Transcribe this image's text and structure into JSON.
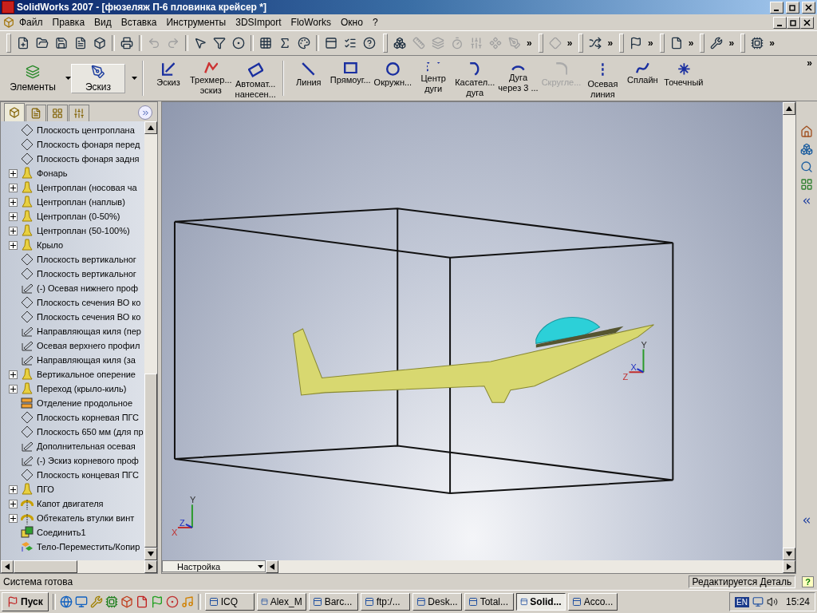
{
  "window": {
    "title": "SolidWorks 2007 - [фюзеляж П-6 пловинка крейсер *]"
  },
  "menu": [
    "Файл",
    "Правка",
    "Вид",
    "Вставка",
    "Инструменты",
    "3DSImport",
    "FloWorks",
    "Окно",
    "?"
  ],
  "standard_toolbar": [
    {
      "kind": "button",
      "disabled": false
    },
    {
      "kind": "button",
      "disabled": false
    },
    {
      "kind": "button",
      "disabled": false
    },
    {
      "kind": "button",
      "disabled": false
    },
    {
      "kind": "button",
      "disabled": false
    },
    {
      "kind": "separator"
    },
    {
      "kind": "button",
      "disabled": false
    },
    {
      "kind": "separator"
    },
    {
      "kind": "button",
      "disabled": true
    },
    {
      "kind": "button",
      "disabled": true
    },
    {
      "kind": "separator"
    },
    {
      "kind": "button",
      "disabled": false
    },
    {
      "kind": "button",
      "disabled": false
    },
    {
      "kind": "button",
      "disabled": false
    },
    {
      "kind": "separator"
    },
    {
      "kind": "button",
      "disabled": false
    },
    {
      "kind": "button",
      "disabled": false
    },
    {
      "kind": "button",
      "disabled": false
    },
    {
      "kind": "separator"
    },
    {
      "kind": "button",
      "disabled": false
    },
    {
      "kind": "button",
      "disabled": false
    },
    {
      "kind": "button",
      "disabled": false
    },
    {
      "kind": "grip"
    },
    {
      "kind": "button",
      "disabled": false
    },
    {
      "kind": "button",
      "disabled": true
    },
    {
      "kind": "button",
      "disabled": true
    },
    {
      "kind": "button",
      "disabled": true
    },
    {
      "kind": "button",
      "disabled": true
    },
    {
      "kind": "button",
      "disabled": true
    },
    {
      "kind": "button",
      "disabled": true
    },
    {
      "kind": "chevron",
      "label": "»"
    },
    {
      "kind": "grip"
    },
    {
      "kind": "button",
      "disabled": true
    },
    {
      "kind": "chevron",
      "label": "»"
    },
    {
      "kind": "grip"
    },
    {
      "kind": "button",
      "disabled": false
    },
    {
      "kind": "chevron",
      "label": "»"
    },
    {
      "kind": "grip"
    },
    {
      "kind": "button",
      "disabled": false
    },
    {
      "kind": "chevron",
      "label": "»"
    },
    {
      "kind": "grip"
    },
    {
      "kind": "button",
      "disabled": false
    },
    {
      "kind": "chevron",
      "label": "»"
    },
    {
      "kind": "grip"
    },
    {
      "kind": "button",
      "disabled": false
    },
    {
      "kind": "chevron",
      "label": "»"
    },
    {
      "kind": "grip"
    },
    {
      "kind": "button",
      "disabled": false
    },
    {
      "kind": "chevron",
      "label": "»"
    }
  ],
  "command_manager": [
    {
      "kind": "big",
      "label": "Элементы",
      "selected": false
    },
    {
      "kind": "big",
      "label": "Эскиз",
      "selected": true
    },
    {
      "kind": "separator"
    },
    {
      "kind": "tool",
      "label": "Эскиз",
      "disabled": false
    },
    {
      "kind": "tool",
      "label": "Трехмер...\nэскиз",
      "disabled": false
    },
    {
      "kind": "tool",
      "label": "Автомат...\nнанесен...",
      "disabled": false
    },
    {
      "kind": "separator"
    },
    {
      "kind": "tool",
      "label": "Линия",
      "disabled": false
    },
    {
      "kind": "tool",
      "label": "Прямоуг...",
      "disabled": false
    },
    {
      "kind": "tool",
      "label": "Окружн...",
      "disabled": false
    },
    {
      "kind": "tool",
      "label": "Центр\nдуги",
      "disabled": false
    },
    {
      "kind": "tool",
      "label": "Касател...\nдуга",
      "disabled": false
    },
    {
      "kind": "tool",
      "label": "Дуга\nчерез 3 ...",
      "disabled": false
    },
    {
      "kind": "tool",
      "label": "Скругле...",
      "disabled": true
    },
    {
      "kind": "tool",
      "label": "Осевая\nлиния",
      "disabled": false
    },
    {
      "kind": "tool",
      "label": "Сплайн",
      "disabled": false
    },
    {
      "kind": "tool",
      "label": "Точечный",
      "disabled": false
    }
  ],
  "command_manager_more": "»",
  "tree_tabs": [
    {
      "selected": true
    },
    {
      "selected": false
    },
    {
      "selected": false
    },
    {
      "selected": false
    }
  ],
  "tree": [
    {
      "kind": "plane",
      "label": "Плоскость центроплана",
      "expandable": false
    },
    {
      "kind": "plane",
      "label": "Плоскость фонаря перед",
      "expandable": false
    },
    {
      "kind": "plane",
      "label": "Плоскость фонаря задня",
      "expandable": false
    },
    {
      "kind": "loft",
      "label": "Фонарь",
      "expandable": true
    },
    {
      "kind": "loft",
      "label": "Центроплан (носовая ча",
      "expandable": true
    },
    {
      "kind": "loft",
      "label": "Центроплан (наплыв)",
      "expandable": true
    },
    {
      "kind": "loft",
      "label": "Центроплан (0-50%)",
      "expandable": true
    },
    {
      "kind": "loft",
      "label": "Центроплан (50-100%)",
      "expandable": true
    },
    {
      "kind": "loft",
      "label": "Крыло",
      "expandable": true
    },
    {
      "kind": "plane",
      "label": "Плоскость вертикальног",
      "expandable": false
    },
    {
      "kind": "plane",
      "label": "Плоскость вертикальног",
      "expandable": false
    },
    {
      "kind": "sketch",
      "label": "(-) Осевая нижнего проф",
      "expandable": false
    },
    {
      "kind": "plane",
      "label": "Плоскость сечения ВО ко",
      "expandable": false
    },
    {
      "kind": "plane",
      "label": "Плоскость сечения ВО ко",
      "expandable": false
    },
    {
      "kind": "sketch",
      "label": "Направляющая киля (пер",
      "expandable": false
    },
    {
      "kind": "sketch",
      "label": "Осевая верхнего профил",
      "expandable": false
    },
    {
      "kind": "sketch",
      "label": "Направляющая киля (за",
      "expandable": false
    },
    {
      "kind": "loft",
      "label": "Вертикальное оперение",
      "expandable": true
    },
    {
      "kind": "loft",
      "label": "Переход (крыло-киль)",
      "expandable": true
    },
    {
      "kind": "split",
      "label": "Отделение продольное",
      "expandable": false
    },
    {
      "kind": "plane",
      "label": "Плоскость корневая ПГС",
      "expandable": false
    },
    {
      "kind": "plane",
      "label": "Плоскость 650 мм (для пр",
      "expandable": false
    },
    {
      "kind": "sketch",
      "label": "Дополнительная осевая",
      "expandable": false
    },
    {
      "kind": "sketch",
      "label": "(-) Эскиз корневого проф",
      "expandable": false
    },
    {
      "kind": "plane",
      "label": "Плоскость концевая ПГС",
      "expandable": false
    },
    {
      "kind": "loft",
      "label": "ПГО",
      "expandable": true
    },
    {
      "kind": "revolve",
      "label": "Капот двигателя",
      "expandable": true
    },
    {
      "kind": "revolve",
      "label": "Обтекатель втулки винт",
      "expandable": true
    },
    {
      "kind": "combine",
      "label": "Соединить1",
      "expandable": false
    },
    {
      "kind": "move",
      "label": "Тело-Переместить/Копир",
      "expandable": false
    }
  ],
  "triads": [
    {
      "labels": [
        "Y",
        "Z",
        "X"
      ]
    },
    {
      "labels": [
        "Y",
        "X",
        "Z"
      ]
    }
  ],
  "configuration": {
    "value": "Настройка"
  },
  "status_bar": {
    "message": "Система готова",
    "mode": "Редактируется Деталь",
    "help": "?"
  },
  "taskbar": {
    "start": "Пуск",
    "buttons": [
      {
        "label": "ICQ",
        "selected": false
      },
      {
        "label": "Alex_M",
        "selected": false
      },
      {
        "label": "Barc...",
        "selected": false
      },
      {
        "label": "ftp:/...",
        "selected": false
      },
      {
        "label": "Desk...",
        "selected": false
      },
      {
        "label": "Total...",
        "selected": false
      },
      {
        "label": "Solid...",
        "selected": true
      },
      {
        "label": "Acco...",
        "selected": false
      }
    ],
    "language": "EN",
    "clock": "15:24"
  }
}
